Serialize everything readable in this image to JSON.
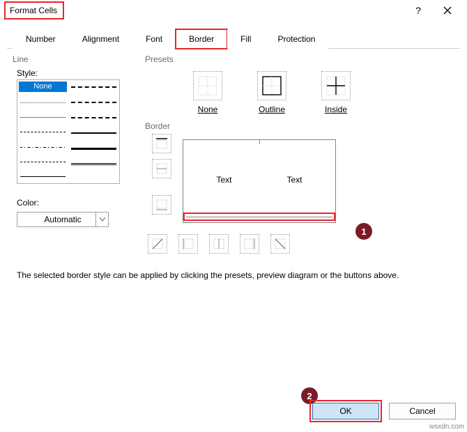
{
  "title": "Format Cells",
  "tabs": {
    "number": "Number",
    "alignment": "Alignment",
    "font": "Font",
    "border": "Border",
    "fill": "Fill",
    "protection": "Protection"
  },
  "line": {
    "section": "Line",
    "style_label": "Style:",
    "none": "None",
    "color_label": "Color:",
    "color_value": "Automatic"
  },
  "presets": {
    "section": "Presets",
    "none": "None",
    "outline": "Outline",
    "inside": "Inside"
  },
  "border": {
    "section": "Border",
    "preview_text_left": "Text",
    "preview_text_right": "Text"
  },
  "help_text": "The selected border style can be applied by clicking the presets, preview diagram or the buttons above.",
  "buttons": {
    "ok": "OK",
    "cancel": "Cancel"
  },
  "callouts": {
    "one": "1",
    "two": "2"
  },
  "watermark": "wsxdn.com"
}
